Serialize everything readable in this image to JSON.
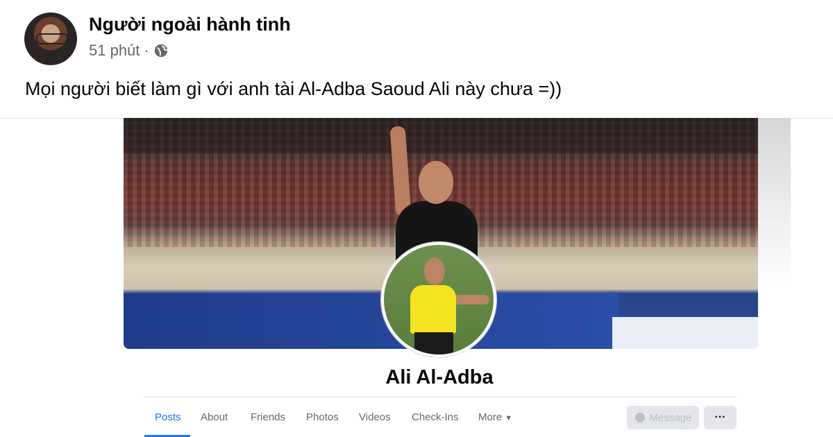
{
  "post": {
    "author": "Người ngoài hành tinh",
    "time": "51 phút",
    "separator": "·",
    "privacy_icon": "globe-icon",
    "text": "Mọi người biết làm gì với anh tài Al-Adba Saoud Ali này chưa =))"
  },
  "shared_profile": {
    "name": "Ali Al-Adba",
    "tabs": [
      {
        "label": "Posts",
        "active": true
      },
      {
        "label": "About",
        "active": false
      },
      {
        "label": "Friends",
        "active": false
      },
      {
        "label": "Photos",
        "active": false
      },
      {
        "label": "Videos",
        "active": false
      },
      {
        "label": "Check-Ins",
        "active": false
      },
      {
        "label": "More",
        "active": false
      }
    ],
    "more_caret": "▼",
    "message_label": "Message",
    "ellipsis_label": "···"
  },
  "colors": {
    "accent": "#1877f2",
    "text_primary": "#050505",
    "text_secondary": "#65676b",
    "button_bg": "#e4e6eb"
  }
}
